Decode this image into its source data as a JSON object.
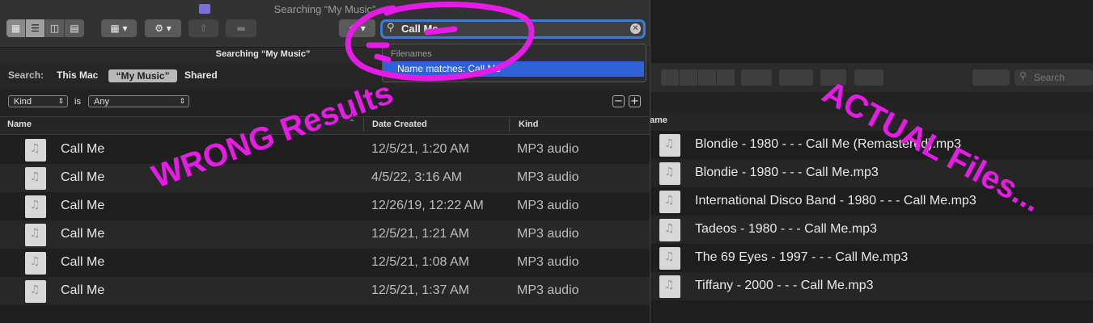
{
  "window": {
    "title": "Searching “My Music”",
    "subtitle": "Searching “My Music”"
  },
  "search": {
    "value": "Call Me",
    "suggestion_header": "Filenames",
    "suggestion_item": "Name matches: Call Me"
  },
  "scope_bar": {
    "label": "Search:",
    "options": [
      "This Mac",
      "“My Music”",
      "Shared"
    ],
    "selected": "“My Music”"
  },
  "criteria": {
    "attribute": "Kind",
    "operator": "is",
    "value": "Any"
  },
  "columns": [
    "Name",
    "Date Created",
    "Kind"
  ],
  "results": [
    {
      "name": "Call Me",
      "date": "12/5/21, 1:20 AM",
      "kind": "MP3 audio"
    },
    {
      "name": "Call Me",
      "date": "4/5/22, 3:16 AM",
      "kind": "MP3 audio"
    },
    {
      "name": "Call Me",
      "date": "12/26/19, 12:22 AM",
      "kind": "MP3 audio"
    },
    {
      "name": "Call Me",
      "date": "12/5/21, 1:21 AM",
      "kind": "MP3 audio"
    },
    {
      "name": "Call Me",
      "date": "12/5/21, 1:08 AM",
      "kind": "MP3 audio"
    },
    {
      "name": "Call Me",
      "date": "12/5/21, 1:37 AM",
      "kind": "MP3 audio"
    }
  ],
  "background_window": {
    "search_placeholder": "Search",
    "column_name": "ame",
    "files": [
      "Blondie - 1980 -  -  - Call Me (Remastered).mp3",
      "Blondie - 1980 -  -  - Call Me.mp3",
      "International Disco Band - 1980 -  -  - Call Me.mp3",
      "Tadeos - 1980 -  -  - Call Me.mp3",
      "The 69 Eyes - 1997 -  -  - Call Me.mp3",
      "Tiffany - 2000 -  -  - Call Me.mp3"
    ]
  },
  "annotations": {
    "wrong": "WRONG Results",
    "actual": "ACTUAL Files...",
    "color": "#e61be6"
  },
  "colors": {
    "accent": "#3b7bd6",
    "selection": "#2f62d6"
  }
}
